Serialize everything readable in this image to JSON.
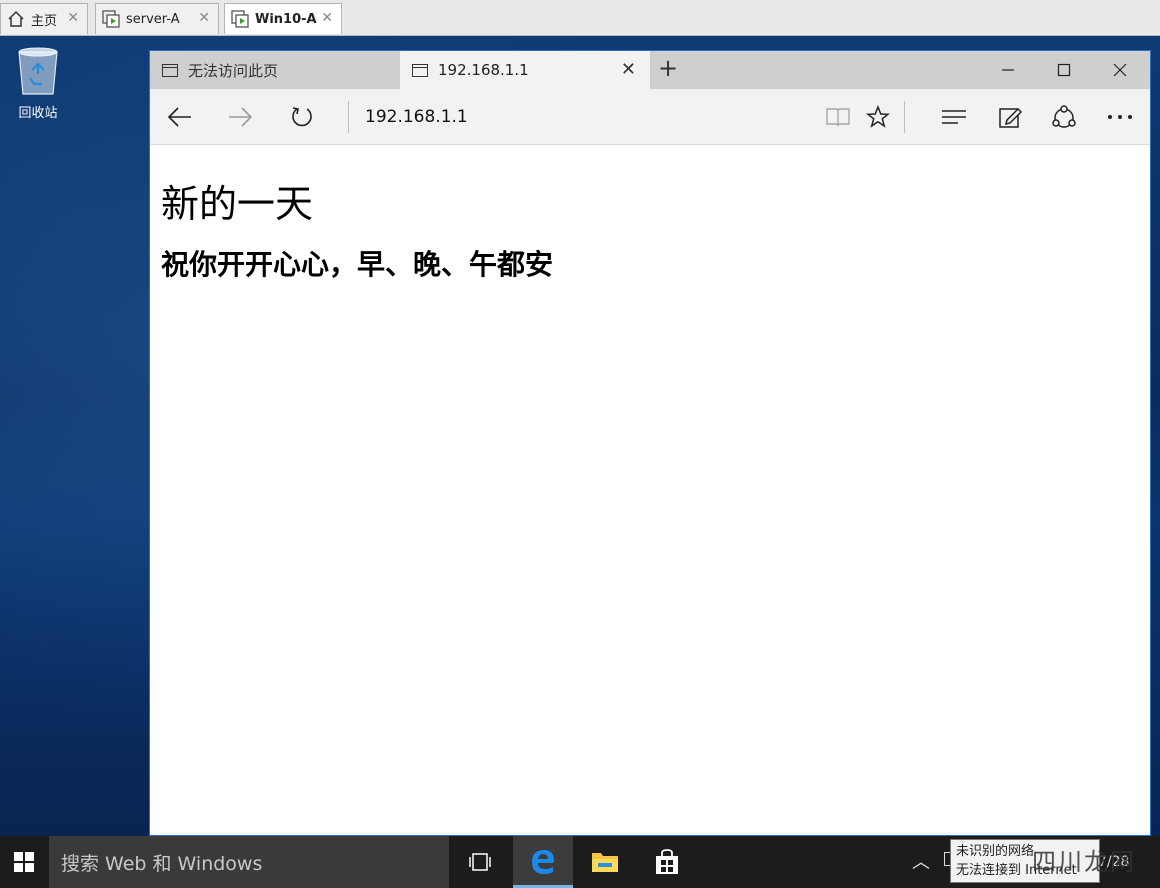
{
  "vm_tabs": [
    {
      "label": "主页",
      "active": false
    },
    {
      "label": "server-A",
      "active": false
    },
    {
      "label": "Win10-A",
      "active": true
    }
  ],
  "desktop": {
    "recycle_bin_label": "回收站"
  },
  "browser": {
    "tabs": [
      {
        "title": "无法访问此页",
        "active": false
      },
      {
        "title": "192.168.1.1",
        "active": true
      }
    ],
    "address": "192.168.1.1"
  },
  "page": {
    "heading": "新的一天",
    "subheading": "祝你开开心心，早、晚、午都安"
  },
  "taskbar": {
    "search_placeholder": "搜索 Web 和 Windows",
    "clock_fragment": "7/28"
  },
  "network_tooltip": {
    "line1": "未识别的网络",
    "line2": "无法连接到 Internet"
  },
  "watermark": "四川龙网",
  "colors": {
    "desktop_bg": "#0e3a73",
    "window_border": "#2c6fc4",
    "taskbar_bg": "#1c1c1c",
    "edge_accent": "#1e88e5"
  }
}
